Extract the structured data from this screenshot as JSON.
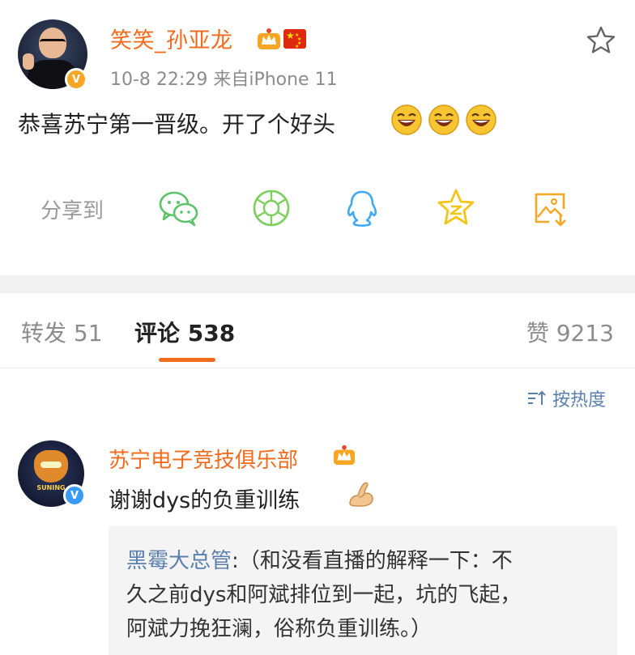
{
  "post": {
    "username": "笑笑_孙亚龙",
    "time": "10-8 22:29",
    "source": "来自iPhone 11",
    "text": "恭喜苏宁第一晋级。开了个好头",
    "verified_badge": "V",
    "emoji_count": 3
  },
  "share": {
    "label": "分享到",
    "targets": [
      "wechat-icon",
      "moments-icon",
      "qq-icon",
      "qzone-icon",
      "save-image-icon"
    ]
  },
  "tabs": {
    "repost": "转发 51",
    "comment": "评论 538",
    "like": "赞 9213"
  },
  "sort": {
    "label": "按热度"
  },
  "comment": {
    "username": "苏宁电子竞技俱乐部",
    "text": "谢谢dys的负重训练",
    "avatar_text": "SUNING",
    "verified_badge": "V",
    "reply": {
      "user": "黑霉大总管",
      "line1_rest": ":（和没看直播的解释一下：不",
      "line2": "久之前dys和阿斌排位到一起，坑的飞起，",
      "line3": "阿斌力挽狂澜，俗称负重训练。）"
    }
  },
  "colors": {
    "accent": "#f26b1d",
    "link": "#5a7fae",
    "share_green": "#5ec26a",
    "share_blue": "#3fa9f5",
    "share_yellow": "#f5c419"
  }
}
